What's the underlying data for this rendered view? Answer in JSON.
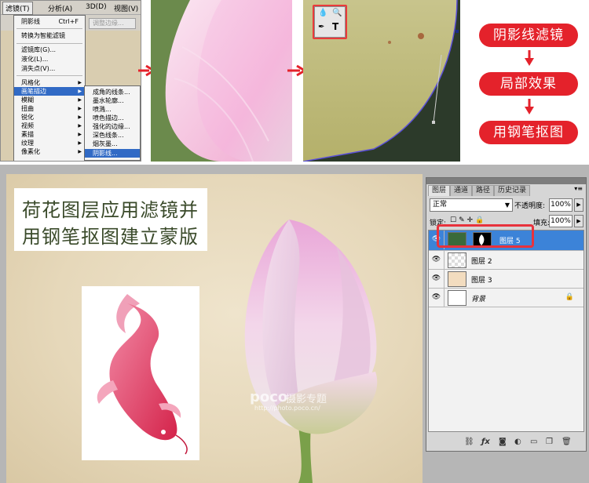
{
  "menu_bar": {
    "filter": "滤镜(T)",
    "analysis": "分析(A)",
    "three_d": "3D(D)",
    "view": "视图(V)"
  },
  "options_bar": {
    "adjust_edge": "调整边缘..."
  },
  "filter_menu": {
    "items": [
      {
        "label": "阴影线",
        "shortcut": "Ctrl+F"
      },
      {
        "label": "转换为智能滤镜"
      },
      {
        "label": "滤镜库(G)..."
      },
      {
        "label": "液化(L)..."
      },
      {
        "label": "消失点(V)..."
      },
      {
        "label": "风格化"
      },
      {
        "label": "画笔描边"
      },
      {
        "label": "模糊"
      },
      {
        "label": "扭曲"
      },
      {
        "label": "锐化"
      },
      {
        "label": "视频"
      },
      {
        "label": "素描"
      },
      {
        "label": "纹理"
      },
      {
        "label": "像素化"
      }
    ]
  },
  "brush_submenu": {
    "items": [
      "成角的线条...",
      "墨水轮廓...",
      "喷溅...",
      "喷色描边...",
      "强化的边缘...",
      "深色线条...",
      "烟灰墨...",
      "阴影线..."
    ]
  },
  "toolbox": {
    "t_tool": "T"
  },
  "flow": {
    "step1": "阴影线滤镜",
    "step2": "局部效果",
    "step3": "用钢笔抠图"
  },
  "caption": {
    "line1": "荷花图层应用滤镜并",
    "line2": "用钢笔抠图建立蒙版"
  },
  "watermark": {
    "brand": "poco",
    "sub": "摄影专题",
    "url": "http://photo.poco.cn/"
  },
  "layers_panel": {
    "tabs": [
      "图层",
      "通道",
      "路径",
      "历史记录"
    ],
    "blend_mode": "正常",
    "opacity_label": "不透明度:",
    "opacity_value": "100%",
    "lock_label": "锁定:",
    "fill_label": "填充:",
    "fill_value": "100%",
    "layers": [
      {
        "name": "图层 5"
      },
      {
        "name": "图层 2"
      },
      {
        "name": "图层 3"
      },
      {
        "name": "背景"
      }
    ]
  },
  "colors": {
    "accent_red": "#e4222b",
    "selected_layer": "#3c83d8",
    "menu_highlight": "#316ac5"
  }
}
